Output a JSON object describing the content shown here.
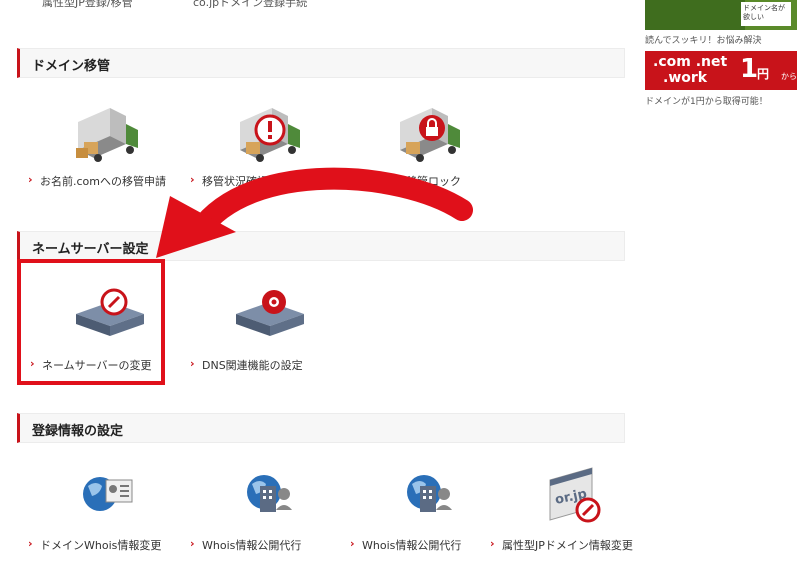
{
  "top_cut": {
    "left_text": "属性型JP登録/移管",
    "mid_text": "co.jpドメイン登録手続"
  },
  "sections": [
    {
      "title": "ドメイン移管",
      "items": [
        {
          "label": "お名前.comへの移管申請",
          "icon": "truck-icon"
        },
        {
          "label": "移管状況確認",
          "icon": "truck-alert-icon"
        },
        {
          "label": "ドメイン移管ロック",
          "icon": "truck-lock-icon"
        }
      ]
    },
    {
      "title": "ネームサーバー設定",
      "items": [
        {
          "label": "ネームサーバーの変更",
          "icon": "server-edit-icon"
        },
        {
          "label": "DNS関連機能の設定",
          "icon": "server-gear-icon"
        }
      ]
    },
    {
      "title": "登録情報の設定",
      "items": [
        {
          "label": "ドメインWhois情報変更",
          "icon": "globe-card-icon"
        },
        {
          "label": "Whois情報公開代行",
          "icon": "globe-building-icon"
        },
        {
          "label": "Whois情報公開代行",
          "icon": "globe-building-icon"
        },
        {
          "label": "属性型JPドメイン情報変更",
          "icon": "orjp-edit-icon"
        }
      ]
    }
  ],
  "sidebar": {
    "thumb_text": "ドメイン名が欲しい",
    "thumb_caption": "読んでスッキリ！お悩み解決",
    "banner": {
      "line1": ".com .net",
      "line2": ".work",
      "price": "1",
      "unit": "円",
      "suffix": "から"
    },
    "banner_caption": "ドメインが1円から取得可能！"
  },
  "colors": {
    "accent": "#c8131a",
    "highlight": "#e0101a"
  }
}
